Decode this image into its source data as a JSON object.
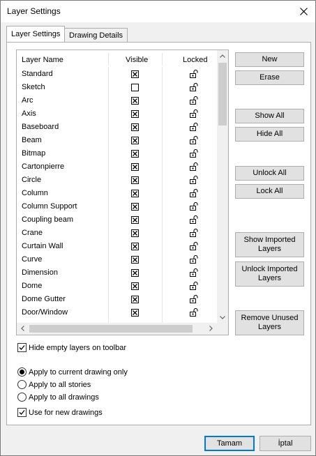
{
  "window": {
    "title": "Layer Settings"
  },
  "tabs": [
    {
      "label": "Layer Settings",
      "active": true
    },
    {
      "label": "Drawing Details",
      "active": false
    }
  ],
  "list": {
    "columns": [
      "Layer Name",
      "Visible",
      "Locked"
    ],
    "rows": [
      {
        "name": "Standard",
        "visible": true
      },
      {
        "name": "Sketch",
        "visible": false
      },
      {
        "name": "Arc",
        "visible": true
      },
      {
        "name": "Axis",
        "visible": true
      },
      {
        "name": "Baseboard",
        "visible": true
      },
      {
        "name": "Beam",
        "visible": true
      },
      {
        "name": "Bitmap",
        "visible": true
      },
      {
        "name": "Cartonpierre",
        "visible": true
      },
      {
        "name": "Circle",
        "visible": true
      },
      {
        "name": "Column",
        "visible": true
      },
      {
        "name": "Column Support",
        "visible": true
      },
      {
        "name": "Coupling beam",
        "visible": true
      },
      {
        "name": "Crane",
        "visible": true
      },
      {
        "name": "Curtain Wall",
        "visible": true
      },
      {
        "name": "Curve",
        "visible": true
      },
      {
        "name": "Dimension",
        "visible": true
      },
      {
        "name": "Dome",
        "visible": true
      },
      {
        "name": "Dome Gutter",
        "visible": true
      },
      {
        "name": "Door/Window",
        "visible": true
      }
    ]
  },
  "buttons": {
    "new": "New",
    "erase": "Erase",
    "show_all": "Show All",
    "hide_all": "Hide All",
    "unlock_all": "Unlock All",
    "lock_all": "Lock All",
    "show_imported": "Show Imported Layers",
    "unlock_imported": "Unlock Imported Layers",
    "remove_unused": "Remove Unused Layers"
  },
  "options": {
    "hide_empty": {
      "label": "Hide empty layers on toolbar",
      "checked": true
    },
    "apply_current": {
      "label": "Apply to current drawing only",
      "selected": true
    },
    "apply_stories": {
      "label": "Apply to all stories",
      "selected": false
    },
    "apply_drawings": {
      "label": "Apply to all drawings",
      "selected": false
    },
    "use_new": {
      "label": "Use for new drawings",
      "checked": true
    }
  },
  "footer": {
    "ok": "Tamam",
    "cancel": "İptal"
  },
  "icons": {
    "close": "close-icon",
    "visible": "checkbox-x-icon",
    "locked": "unlocked-padlock-icon"
  }
}
